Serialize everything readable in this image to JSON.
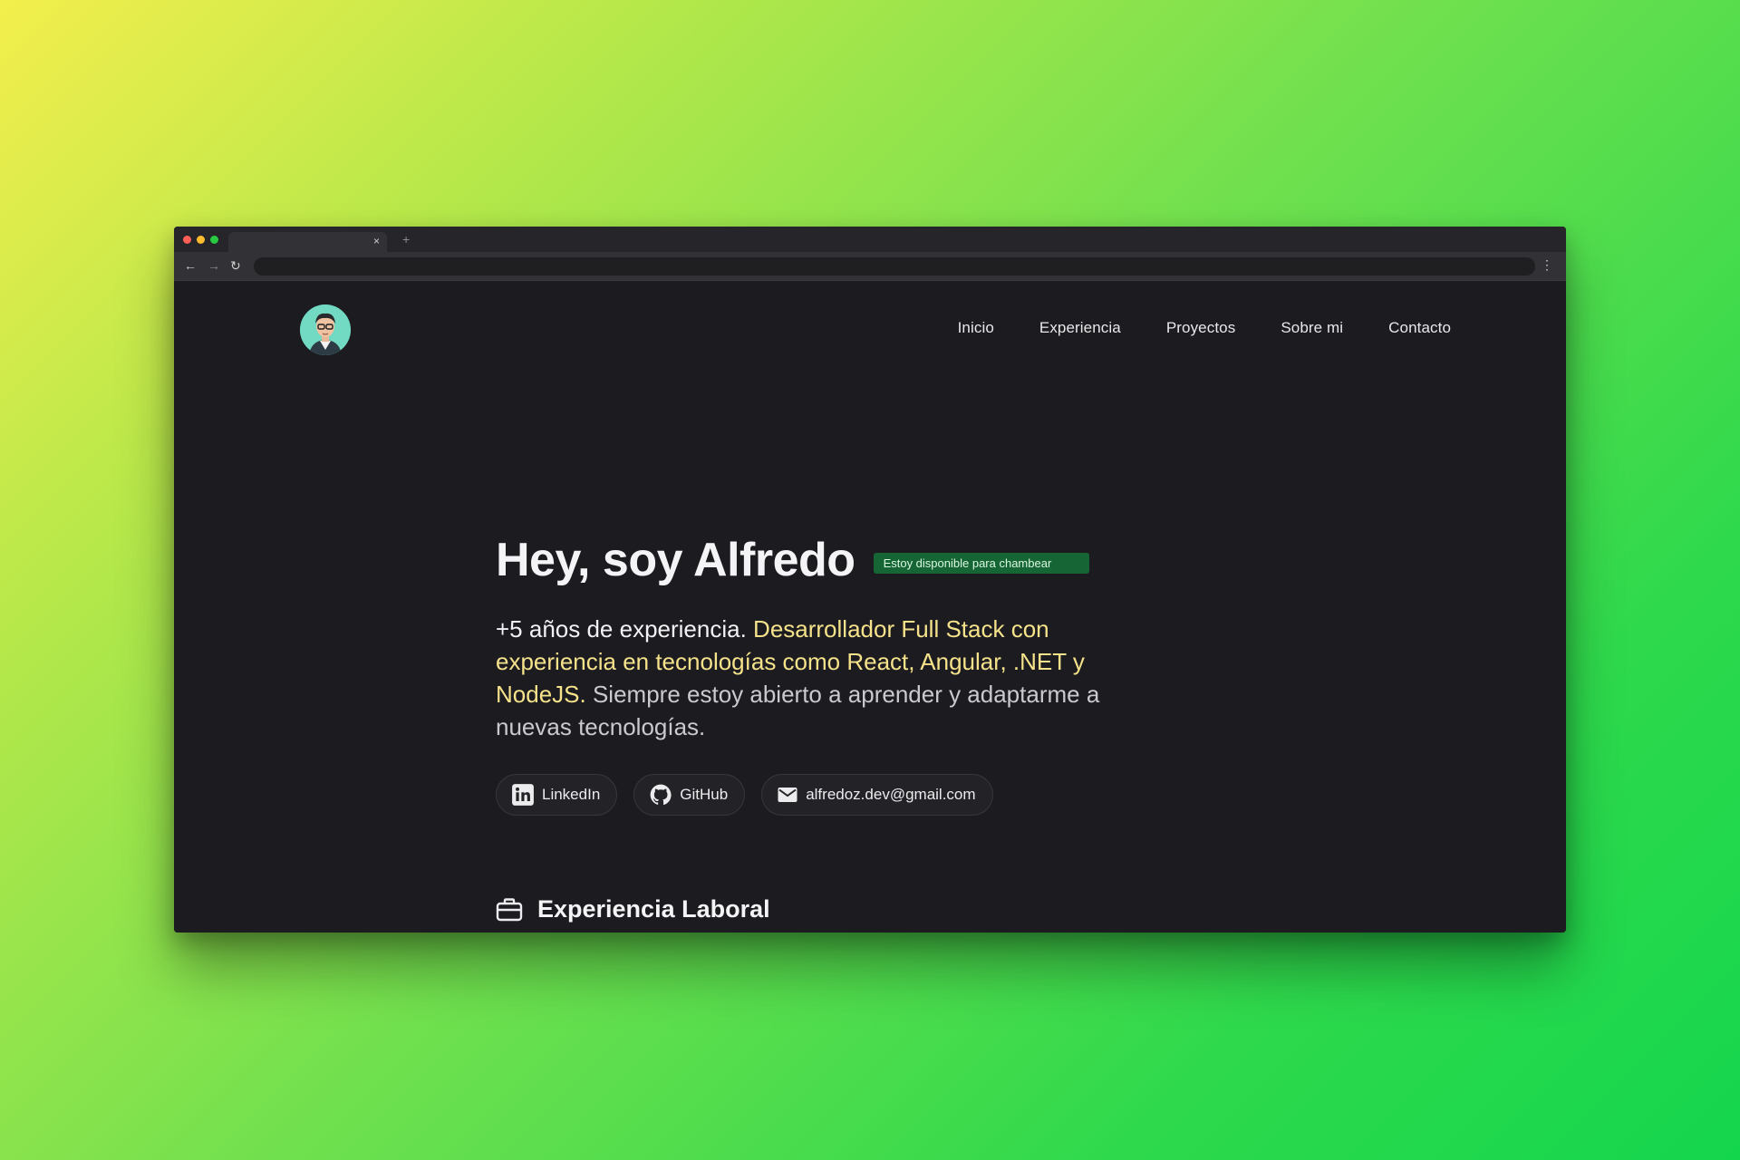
{
  "browser": {
    "tab_close": "×",
    "tab_new": "+",
    "back": "←",
    "forward": "→",
    "reload": "↻",
    "menu": "⋮"
  },
  "nav": {
    "items": [
      {
        "label": "Inicio"
      },
      {
        "label": "Experiencia"
      },
      {
        "label": "Proyectos"
      },
      {
        "label": "Sobre mi"
      },
      {
        "label": "Contacto"
      }
    ]
  },
  "hero": {
    "title": "Hey, soy Alfredo",
    "badge": "Estoy disponible para chambear",
    "desc_lead": "+5 años de experiencia.",
    "desc_highlight": "Desarrollador Full Stack con experiencia en tecnologías como React, Angular, .NET y NodeJS.",
    "desc_rest": "Siempre estoy abierto a aprender y adaptarme a nuevas tecnologías."
  },
  "links": {
    "linkedin": "LinkedIn",
    "github": "GitHub",
    "email": "alfredoz.dev@gmail.com"
  },
  "section": {
    "title": "Experiencia Laboral"
  },
  "colors": {
    "accent_yellow": "#f5e28b",
    "badge_green": "#166534",
    "page_bg": "#1c1c20"
  },
  "icons": {
    "linkedin": "linkedin-icon",
    "github": "github-icon",
    "email": "mail-icon",
    "section": "briefcase-icon"
  }
}
